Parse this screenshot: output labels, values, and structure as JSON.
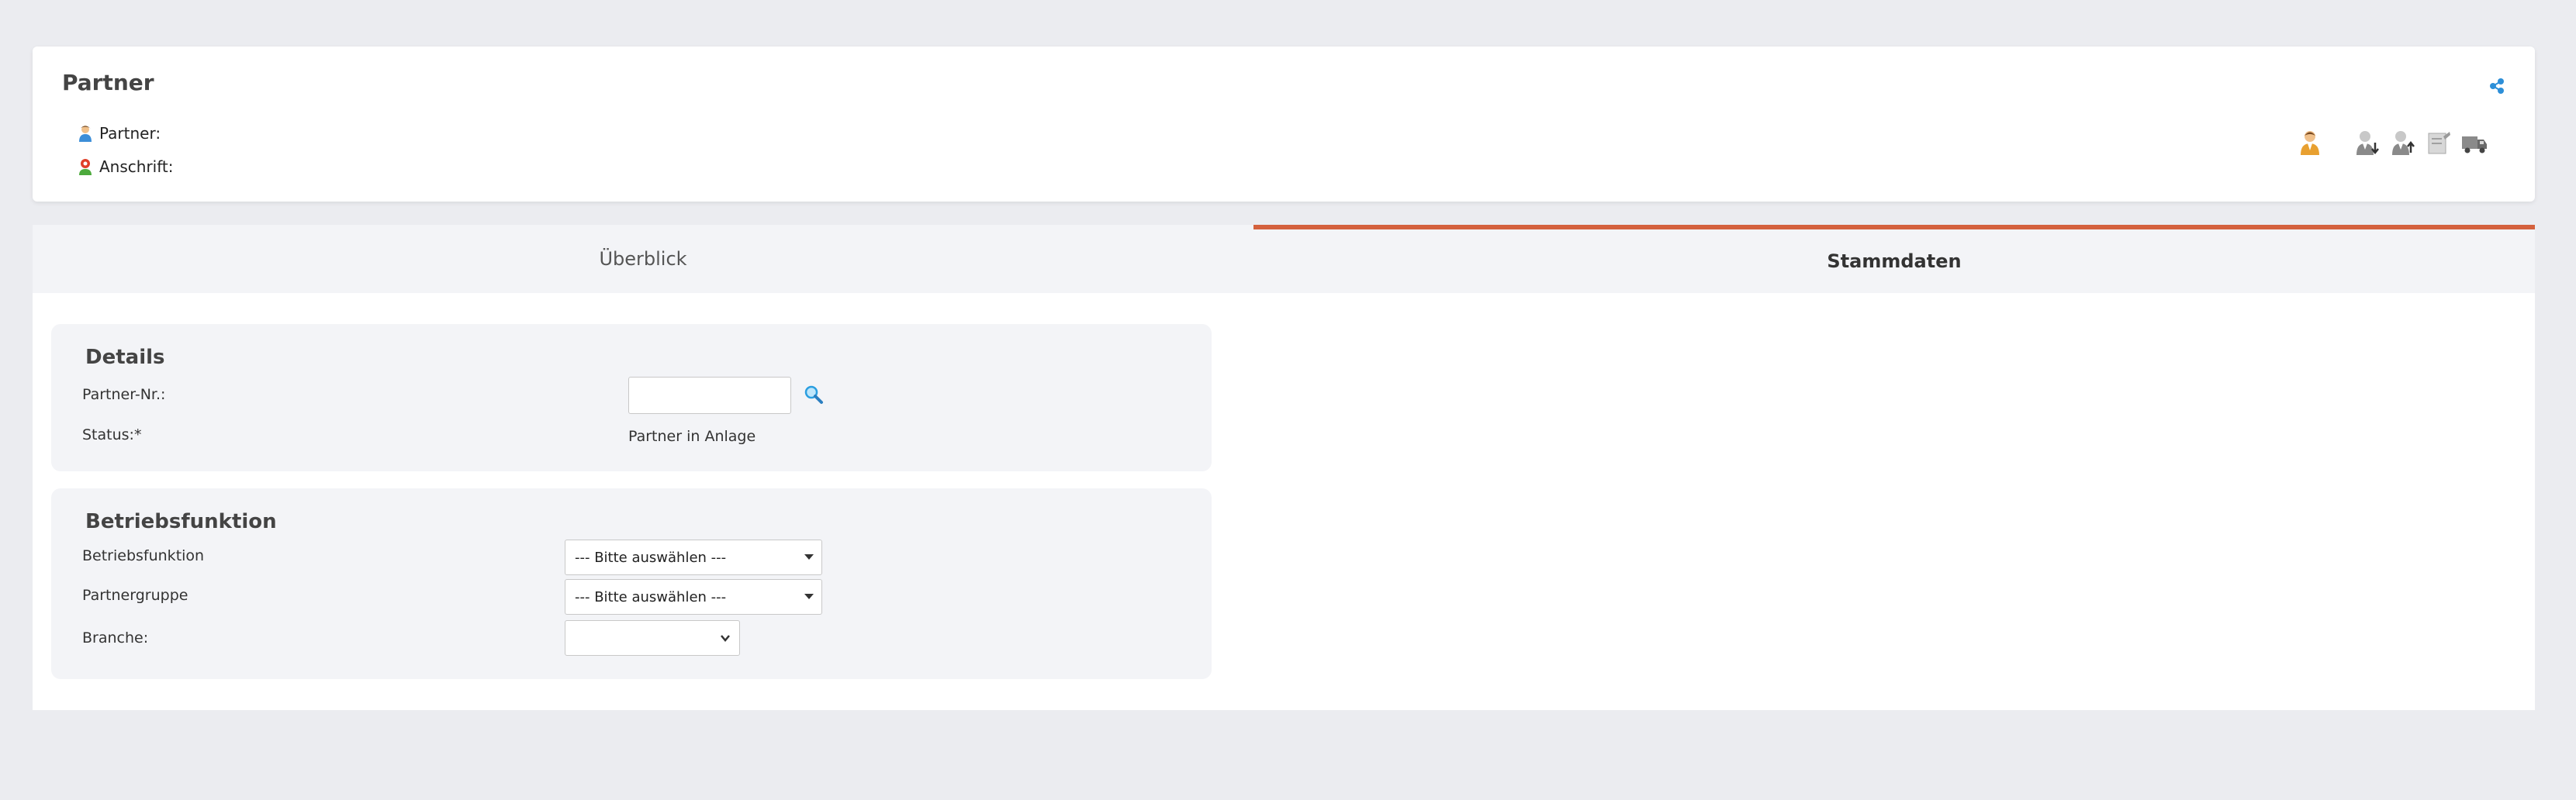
{
  "header": {
    "title": "Partner",
    "partner_label": "Partner:",
    "address_label": "Anschrift:"
  },
  "tabs": [
    {
      "label": "Überblick",
      "active": false
    },
    {
      "label": "Stammdaten",
      "active": true
    }
  ],
  "details": {
    "title": "Details",
    "partner_no_label": "Partner-Nr.:",
    "partner_no_value": "",
    "status_label": "Status:*",
    "status_value": "Partner in Anlage"
  },
  "betrieb": {
    "title": "Betriebsfunktion",
    "betriebsfunktion_label": "Betriebsfunktion",
    "betriebsfunktion_value": "--- Bitte auswählen ---",
    "partnergruppe_label": "Partnergruppe",
    "partnergruppe_value": "--- Bitte auswählen ---",
    "branche_label": "Branche:",
    "branche_value": ""
  },
  "colors": {
    "accent": "#d4613d",
    "page_bg": "#ebecf0",
    "panel_bg": "#f3f4f7"
  },
  "icons": {
    "partner": "person-icon",
    "address": "location-person-icon",
    "share": "share-icon",
    "actions": [
      "person-icon",
      "person-download-icon",
      "person-upload-icon",
      "document-icon",
      "truck-icon"
    ],
    "search": "search-icon"
  }
}
